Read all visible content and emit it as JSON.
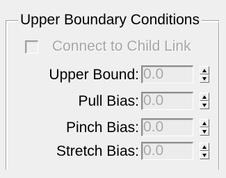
{
  "group": {
    "title": "Upper Boundary Conditions"
  },
  "connect_to_child_link": {
    "label": "Connect to Child Link",
    "checked": false,
    "enabled": false
  },
  "fields": [
    {
      "label": "Upper Bound:",
      "value": "0.0"
    },
    {
      "label": "Pull Bias:",
      "value": "0.0"
    },
    {
      "label": "Pinch Bias:",
      "value": "0.0"
    },
    {
      "label": "Stretch Bias:",
      "value": "0.0"
    }
  ],
  "icons": {
    "spin_up": "triangle-up-icon",
    "spin_down": "triangle-down-icon"
  },
  "colors": {
    "background": "#efefef",
    "disabled_text": "#a6a6a6",
    "field_background": "#ececec"
  }
}
